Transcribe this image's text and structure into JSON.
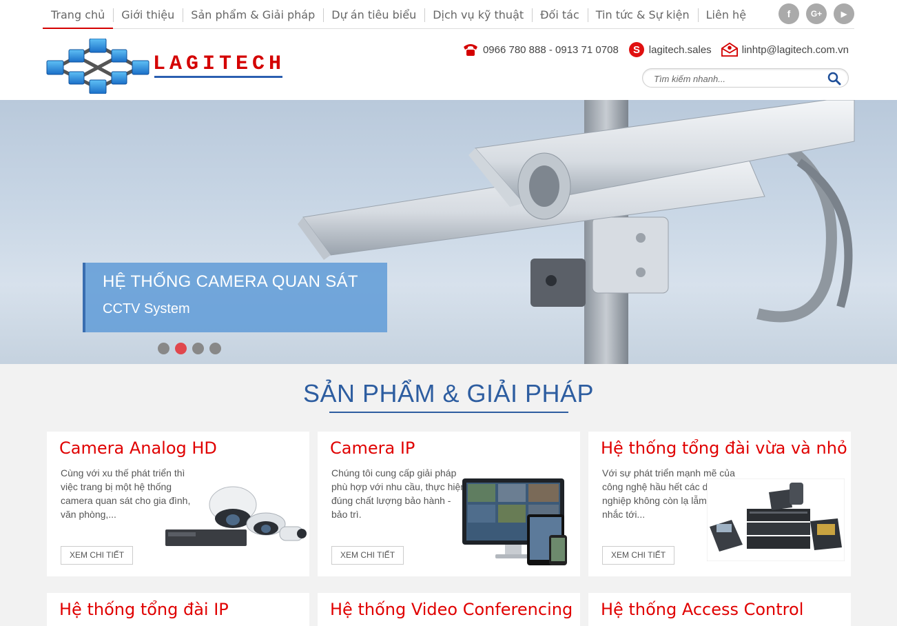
{
  "nav": {
    "items": [
      {
        "label": "Trang chủ",
        "active": true
      },
      {
        "label": "Giới thiệu"
      },
      {
        "label": "Sản phẩm & Giải pháp"
      },
      {
        "label": "Dự án tiêu biểu"
      },
      {
        "label": "Dịch vụ kỹ thuật"
      },
      {
        "label": "Đối tác"
      },
      {
        "label": "Tin tức & Sự kiện"
      },
      {
        "label": "Liên hệ"
      }
    ],
    "social": [
      "f",
      "G+",
      "▶"
    ]
  },
  "logo": {
    "text": "LAGITECH"
  },
  "contacts": {
    "phone": "0966 780 888 - 0913 71 0708",
    "skype": "lagitech.sales",
    "email": "linhtp@lagitech.com.vn"
  },
  "search": {
    "placeholder": "Tìm kiếm nhanh..."
  },
  "hero": {
    "title": "HỆ THỐNG CAMERA QUAN SÁT",
    "subtitle": "CCTV System",
    "slides": 4,
    "active_slide": 2
  },
  "section": {
    "title": "SẢN PHẨM & GIẢI PHÁP"
  },
  "cards": [
    {
      "title": "Camera Analog HD",
      "desc": "Cùng với xu thế phát triển thì việc trang bị một hệ thống camera quan sát cho gia đình, văn phòng,...",
      "button": "XEM CHI TIẾT"
    },
    {
      "title": "Camera IP",
      "desc": "Chúng tôi cung cấp giải pháp phù hợp với nhu cầu, thực hiện đúng chất lượng bảo hành - bảo trì.",
      "button": "XEM CHI TIẾT"
    },
    {
      "title": "Hệ thống tổng đài vừa và nhỏ",
      "desc": "Với sự phát triển mạnh mẽ của công nghệ hầu hết các doanh nghiệp không còn lạ lẫm khi nhắc tới...",
      "button": "XEM CHI TIẾT"
    },
    {
      "title": "Hệ thống tổng đài IP"
    },
    {
      "title": "Hệ thống Video Conferencing"
    },
    {
      "title": "Hệ thống Access Control"
    }
  ],
  "colors": {
    "accent": "#e00000",
    "brand_blue": "#2d5da0",
    "dot_active": "#e0474d"
  }
}
